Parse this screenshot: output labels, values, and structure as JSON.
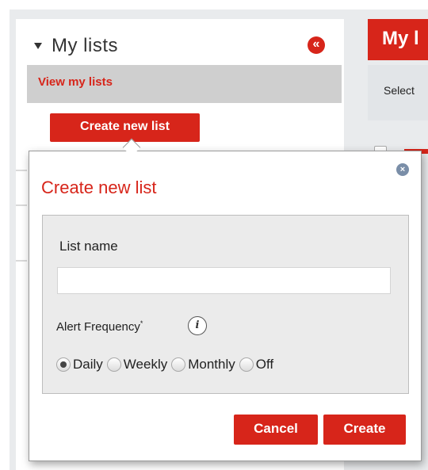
{
  "sidebar": {
    "title": "My lists",
    "collapse_symbol": "«",
    "view_link": "View my lists",
    "create_button": "Create new list"
  },
  "main": {
    "title_fragment": "My l",
    "select_fragment": "Select"
  },
  "popup": {
    "close_symbol": "×",
    "title": "Create new list",
    "list_name_label": "List name",
    "list_name_value": "",
    "alert_label": "Alert Frequency",
    "alert_required_mark": "*",
    "info_symbol": "i",
    "frequency_options": [
      {
        "label": "Daily",
        "selected": true
      },
      {
        "label": "Weekly",
        "selected": false
      },
      {
        "label": "Monthly",
        "selected": false
      },
      {
        "label": "Off",
        "selected": false
      }
    ],
    "cancel_button": "Cancel",
    "create_button": "Create"
  },
  "colors": {
    "accent_red": "#d7251a",
    "panel_gray": "#ebebeb"
  }
}
